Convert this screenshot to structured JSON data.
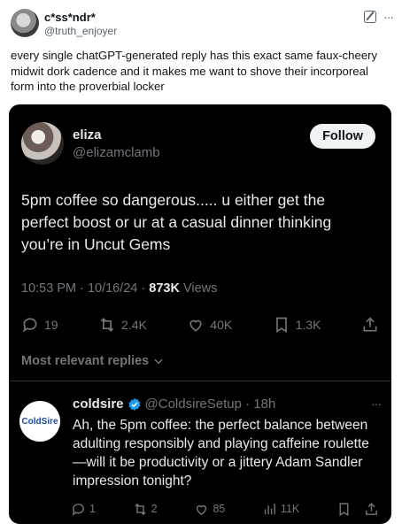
{
  "outer_post": {
    "display_name": "c*ss*ndr*",
    "handle": "@truth_enjoyer",
    "more_label": "···",
    "text": "every single chatGPT-generated reply has this exact same faux-cheery midwit dork cadence and it makes me want to shove their incorporeal form into the proverbial locker"
  },
  "quoted_tweet": {
    "display_name": "eliza",
    "handle": "@elizamclamb",
    "follow_label": "Follow",
    "text": "5pm coffee so dangerous..... u either get the perfect boost or ur at a casual dinner thinking you’re in Uncut Gems",
    "time": "10:53 PM · 10/16/24 · ",
    "views_count": "873K",
    "views_label": " Views",
    "stats": {
      "replies": "19",
      "reposts": "2.4K",
      "likes": "40K",
      "bookmarks": "1.3K"
    },
    "relevant_label": "Most relevant replies"
  },
  "reply": {
    "avatar_text": "ColdSire",
    "display_name": "coldsire",
    "handle_time": "@ColdsireSetup · 18h",
    "more_label": "···",
    "text": "Ah, the 5pm coffee: the perfect balance between adulting responsibly and playing caffeine roulette—will it be productivity or a jittery Adam Sandler impression tonight?",
    "stats": {
      "replies": "1",
      "reposts": "2",
      "likes": "85",
      "views": "11K"
    }
  },
  "colors": {
    "dark_bg": "#000000",
    "muted": "#71767b",
    "verified_blue": "#1d9bf0"
  }
}
